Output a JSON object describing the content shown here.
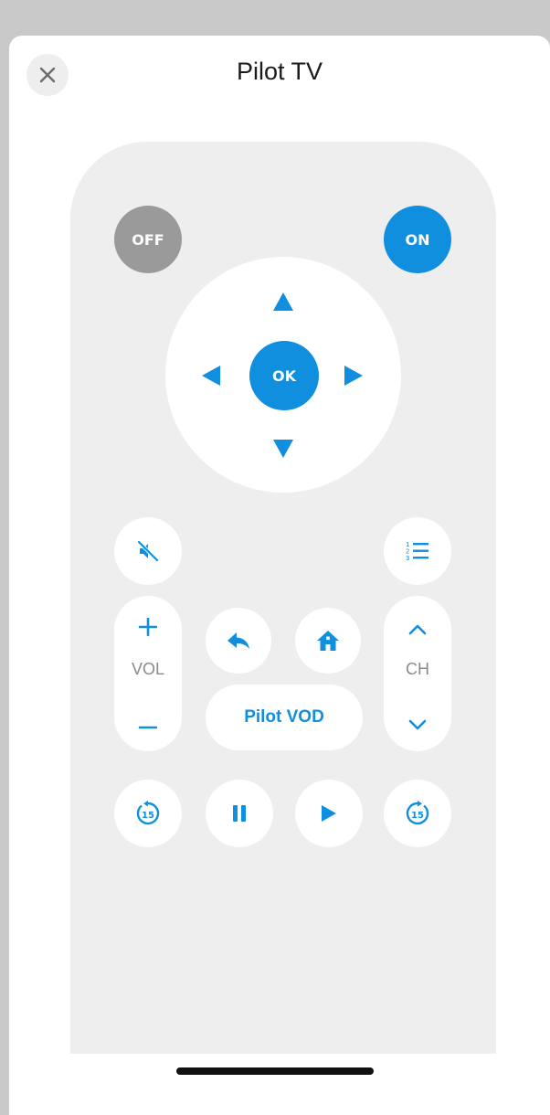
{
  "header": {
    "title": "Pilot TV"
  },
  "remote": {
    "off_label": "OFF",
    "on_label": "ON",
    "ok_label": "OK",
    "vol_label": "VOL",
    "ch_label": "CH",
    "vod_label": "Pilot VOD",
    "replay_seconds": "15",
    "forward_seconds": "15"
  },
  "colors": {
    "accent": "#118fdf",
    "off_button": "#9a9a9a",
    "remote_body": "#eeeeee"
  },
  "icons": [
    "close-icon",
    "mute-icon",
    "channel-list-icon",
    "back-icon",
    "home-icon",
    "replay-15-icon",
    "pause-icon",
    "play-icon",
    "forward-15-icon"
  ]
}
